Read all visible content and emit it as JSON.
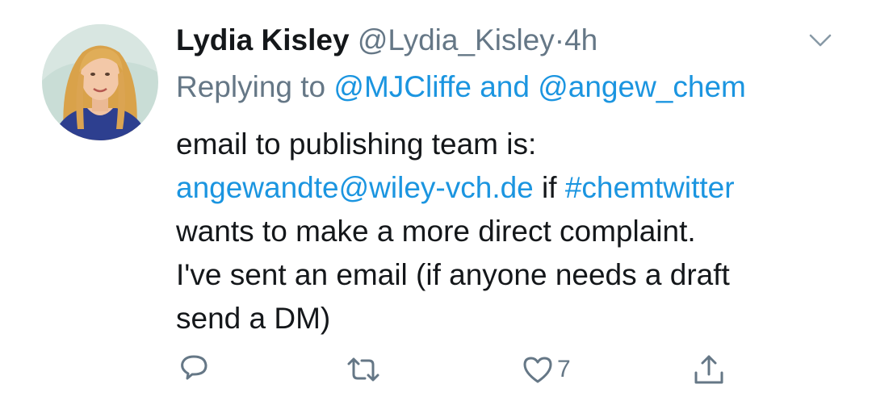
{
  "tweet": {
    "display_name": "Lydia Kisley",
    "handle": "@Lydia_Kisley",
    "separator": "·",
    "time": "4h",
    "reply_prefix": "Replying to",
    "reply_user_1": "@MJCliffe",
    "reply_joiner": "and",
    "reply_user_2": "@angew_chem",
    "body": {
      "line1": "email to publishing team is:",
      "email": "angewandte@wiley-vch.de",
      "if_word": "if",
      "hashtag": "#chemtwitter",
      "line3": "wants to make a more direct complaint.",
      "line4": "I've sent an email (if anyone needs a draft",
      "line5": "send a DM)"
    },
    "likes_count": "7"
  },
  "colors": {
    "text": "#14171a",
    "secondary": "#657786",
    "link": "#1b95e0"
  },
  "icons": {
    "menu": "chevron-down-icon",
    "reply": "reply-icon",
    "retweet": "retweet-icon",
    "like": "heart-icon",
    "share": "share-icon"
  }
}
